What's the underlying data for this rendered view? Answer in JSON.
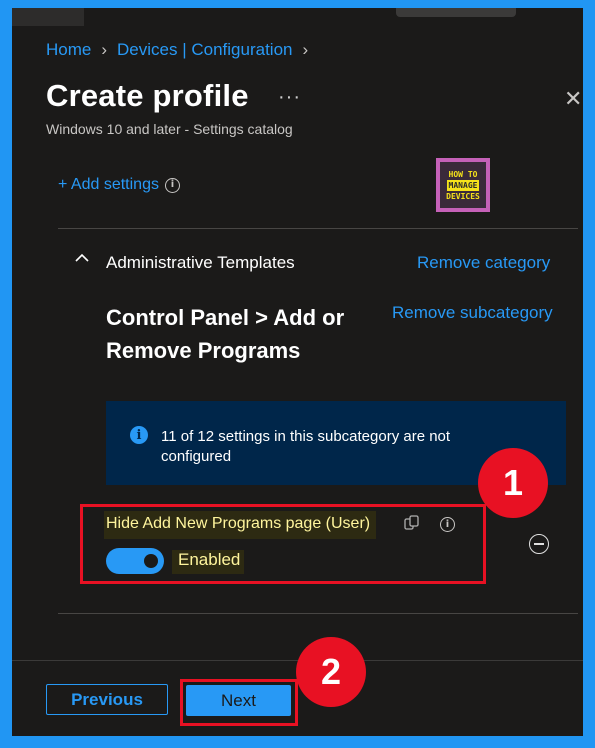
{
  "breadcrumb": {
    "items": [
      "Home",
      "Devices | Configuration"
    ]
  },
  "header": {
    "title": "Create profile",
    "more": "···",
    "subtitle": "Windows 10 and later - Settings catalog"
  },
  "settings": {
    "add_label": "+ Add settings"
  },
  "logo": {
    "line1": "HOW TO",
    "line2": "MANAGE",
    "line3": "DEVICES"
  },
  "category": {
    "name": "Administrative Templates",
    "remove_label": "Remove category",
    "subcategory_title": "Control Panel > Add or Remove Programs",
    "remove_sub_label": "Remove subcategory"
  },
  "info_bar": {
    "message": "11 of 12 settings in this subcategory are not configured"
  },
  "setting": {
    "label": "Hide Add New Programs page (User)",
    "toggle_state": "Enabled",
    "toggle_on": true
  },
  "badges": {
    "one": "1",
    "two": "2"
  },
  "footer": {
    "previous_label": "Previous",
    "next_label": "Next"
  },
  "colors": {
    "accent": "#2899f5",
    "highlight": "#e81123",
    "background": "#1b1a19",
    "border": "#2196f3"
  }
}
